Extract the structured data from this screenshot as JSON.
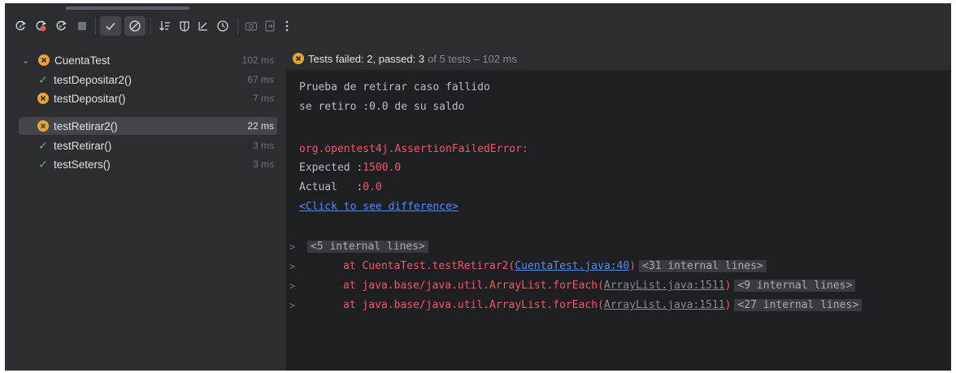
{
  "toolbar": {
    "icons": [
      "rerun-icon",
      "rerun-failed-icon",
      "toggle-auto-test-icon",
      "stop-icon",
      "show-passed-icon",
      "show-ignored-icon",
      "sort-icon",
      "coverage-icon",
      "collapse-icon",
      "history-icon",
      "screenshot-icon",
      "export-icon",
      "more-icon"
    ]
  },
  "tree": {
    "root": {
      "label": "CuentaTest",
      "time": "102 ms"
    },
    "items": [
      {
        "label": "testDepositar2()",
        "time": "67 ms",
        "status": "passed"
      },
      {
        "label": "testDepositar()",
        "time": "7 ms",
        "status": "failed"
      },
      {
        "label": "testRetirar2()",
        "time": "22 ms",
        "status": "failed"
      },
      {
        "label": "testRetirar()",
        "time": "3 ms",
        "status": "passed"
      },
      {
        "label": "testSeters()",
        "time": "3 ms",
        "status": "passed"
      }
    ]
  },
  "status": {
    "failed_text": "Tests failed: 2",
    "passed_text": ", passed: 3",
    "rest_text": "of 5 tests – 102 ms"
  },
  "console": {
    "line1": "Prueba de retirar caso fallido",
    "line2": "se retiro :0.0 de su saldo",
    "error": "org.opentest4j.AssertionFailedError:",
    "expected_label": "Expected :",
    "expected_value": "1500.0",
    "actual_label": "Actual   :",
    "actual_value": "0.0",
    "diff_link": "<Click to see difference>",
    "internal_lines": "<5 internal lines>",
    "stack": [
      {
        "prefix": "at CuentaTest.testRetirar2(",
        "link": "CuentaTest.java:40",
        "suffix": ")",
        "chip": "<31 internal lines>"
      },
      {
        "prefix": "at java.base/java.util.ArrayList.forEach(",
        "link": "ArrayList.java:1511",
        "suffix": ")",
        "chip": "<9 internal lines>"
      },
      {
        "prefix": "at java.base/java.util.ArrayList.forEach(",
        "link": "ArrayList.java:1511",
        "suffix": ")",
        "chip": "<27 internal lines>"
      }
    ]
  }
}
